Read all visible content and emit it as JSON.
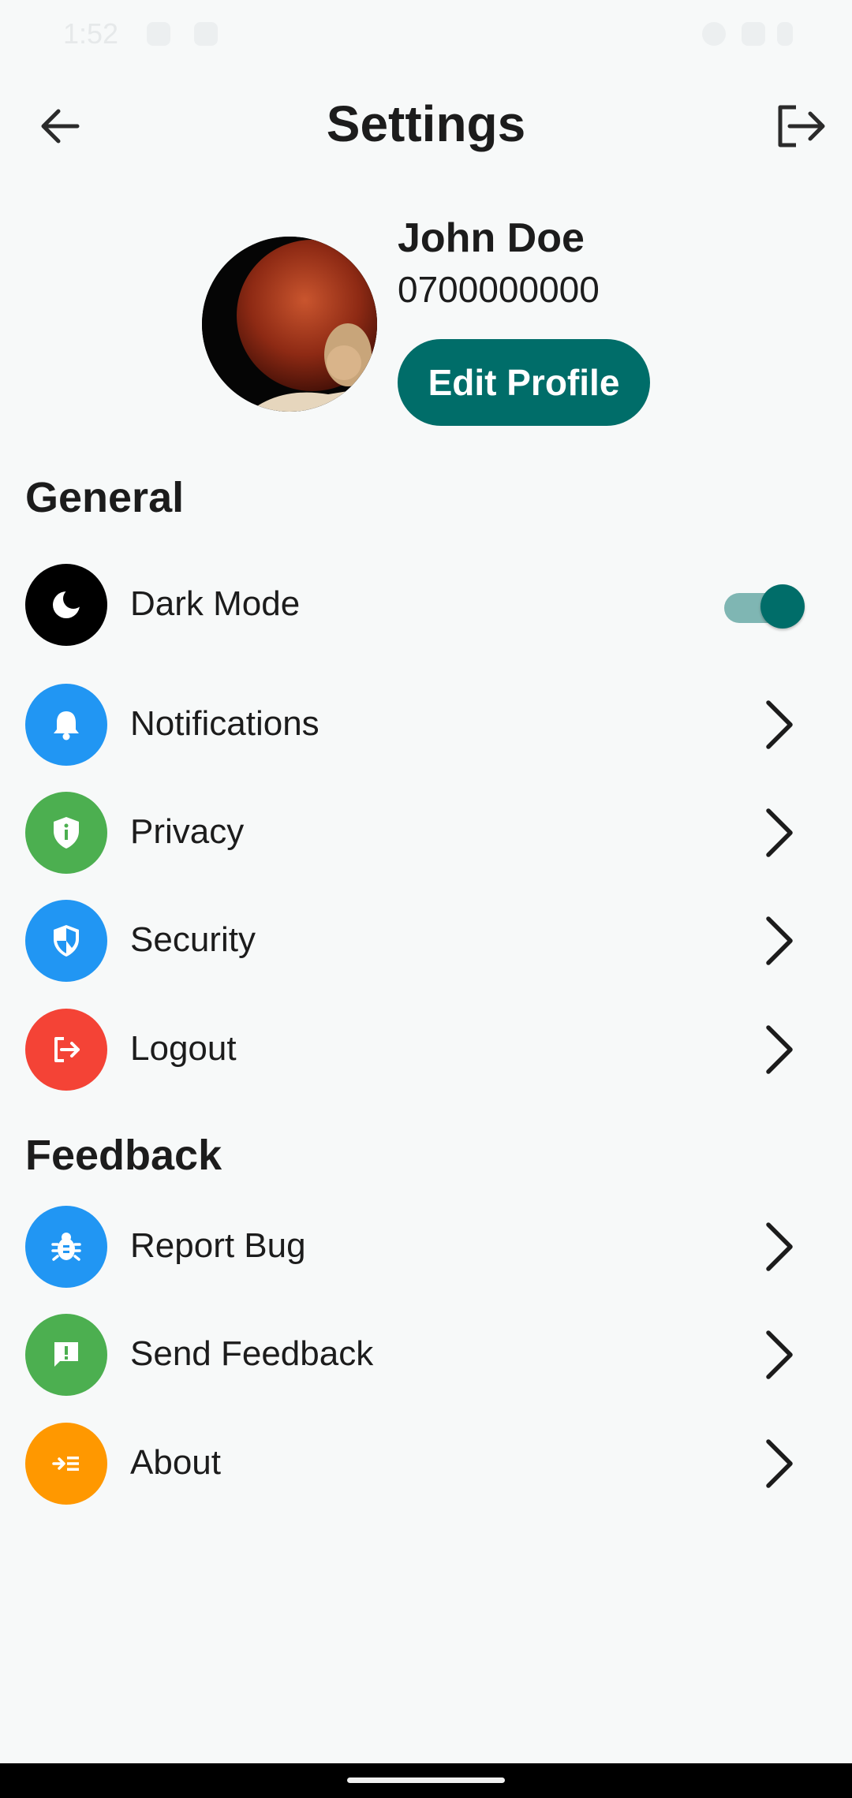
{
  "status_bar": {
    "time": "1:52"
  },
  "header": {
    "title": "Settings"
  },
  "profile": {
    "name": "John Doe",
    "phone": "0700000000",
    "edit_label": "Edit Profile"
  },
  "sections": {
    "general": {
      "title": "General",
      "items": [
        {
          "label": "Dark Mode",
          "icon": "moon-icon",
          "color": "#000000",
          "toggle_on": true
        },
        {
          "label": "Notifications",
          "icon": "bell-icon",
          "color": "#2196f3"
        },
        {
          "label": "Privacy",
          "icon": "shield-info-icon",
          "color": "#4caf50"
        },
        {
          "label": "Security",
          "icon": "security-shield-icon",
          "color": "#2196f3"
        },
        {
          "label": "Logout",
          "icon": "logout-icon",
          "color": "#f44336"
        }
      ]
    },
    "feedback": {
      "title": "Feedback",
      "items": [
        {
          "label": "Report Bug",
          "icon": "bug-icon",
          "color": "#2196f3"
        },
        {
          "label": "Send Feedback",
          "icon": "feedback-icon",
          "color": "#4caf50"
        },
        {
          "label": "About",
          "icon": "about-icon",
          "color": "#ff9800"
        }
      ]
    }
  },
  "colors": {
    "accent": "#006d69",
    "background": "#f7f9f9"
  }
}
